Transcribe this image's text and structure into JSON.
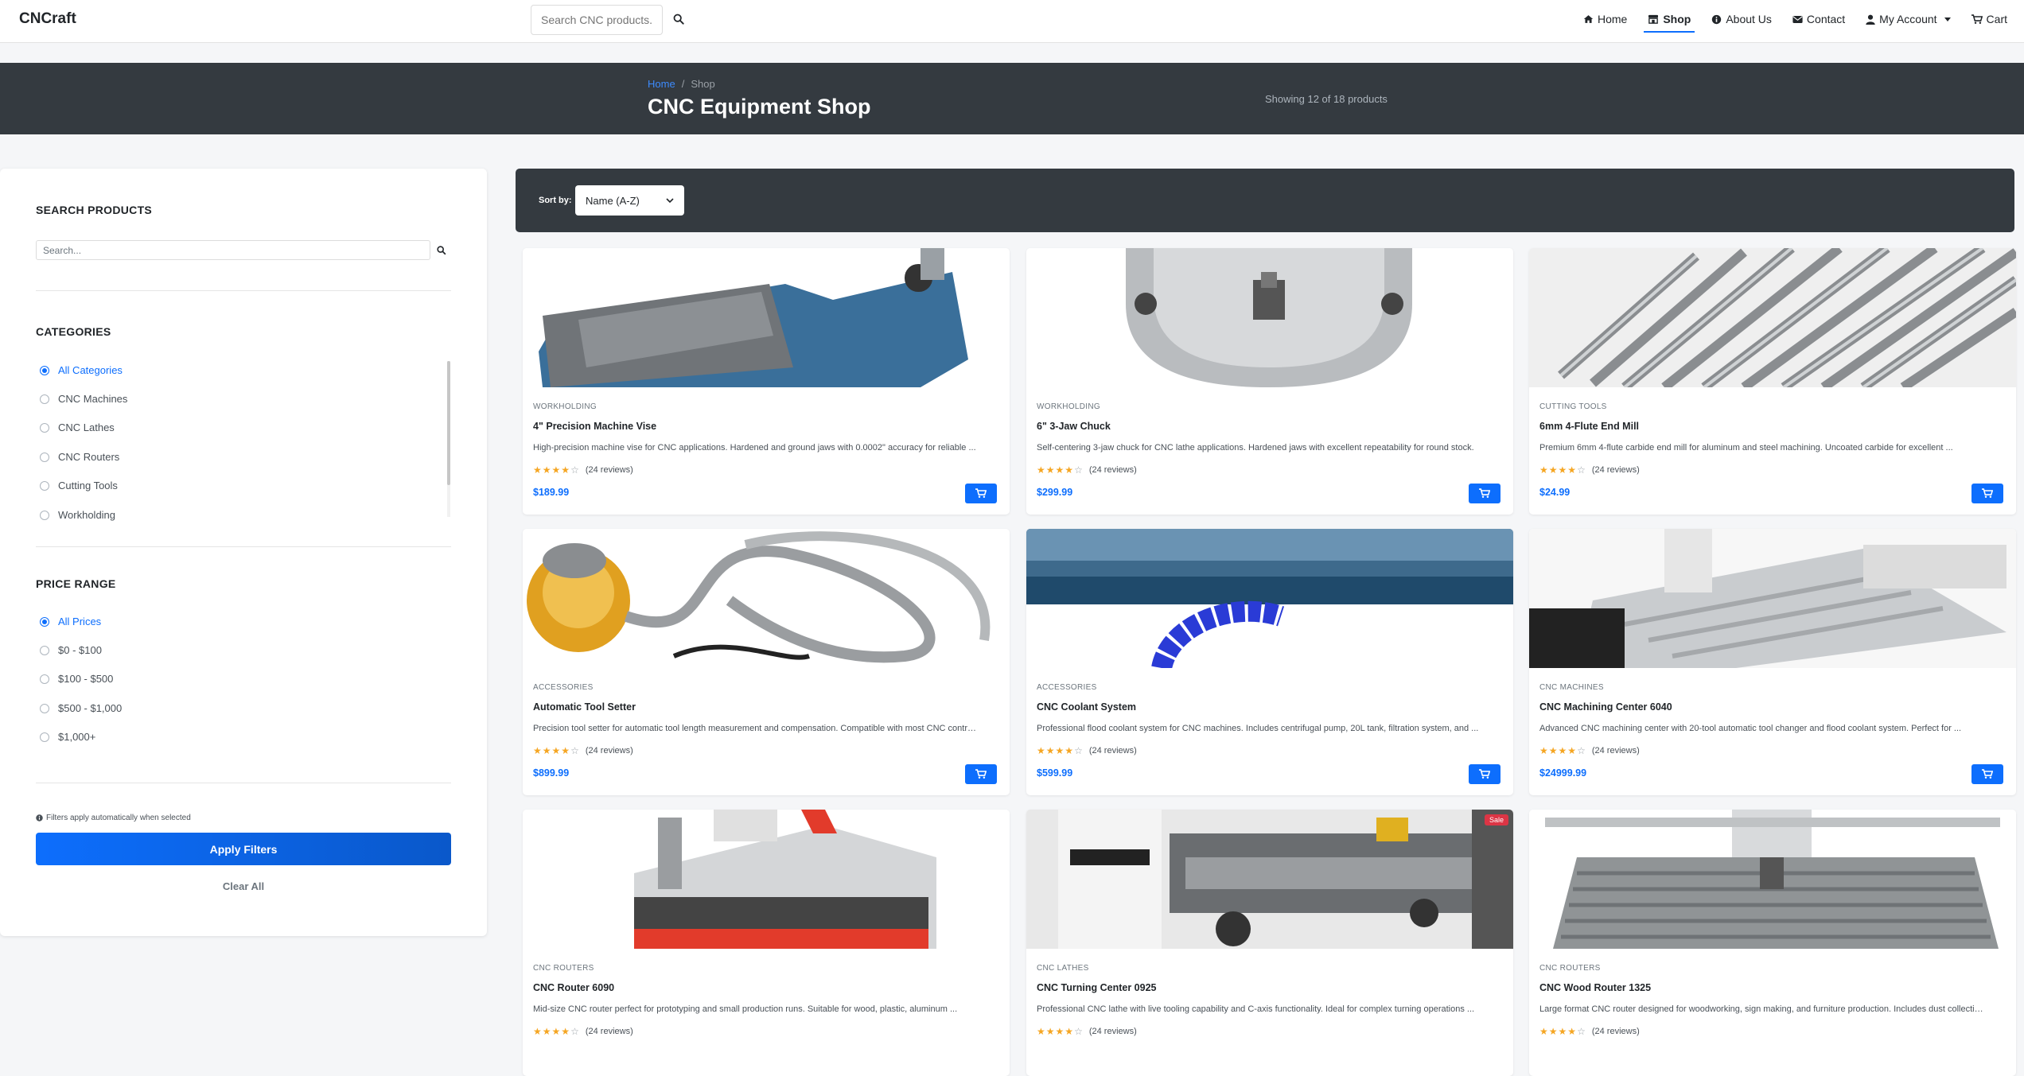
{
  "brand": "CNCraft",
  "nav": {
    "search_placeholder": "Search CNC products...",
    "links": [
      {
        "label": "Home",
        "icon": "home-icon"
      },
      {
        "label": "Shop",
        "icon": "store-icon",
        "active": true
      },
      {
        "label": "About Us",
        "icon": "info-icon"
      },
      {
        "label": "Contact",
        "icon": "envelope-icon"
      },
      {
        "label": "My Account",
        "icon": "user-icon",
        "dropdown": true
      },
      {
        "label": "Cart",
        "icon": "cart-icon"
      }
    ]
  },
  "hero": {
    "breadcrumb": [
      "Home",
      "Shop"
    ],
    "title": "CNC Equipment Shop",
    "count_text": "Showing 12 of 18 products"
  },
  "sidebar": {
    "search_heading": "SEARCH PRODUCTS",
    "search_placeholder": "Search...",
    "categories_heading": "CATEGORIES",
    "categories": [
      "All Categories",
      "CNC Machines",
      "CNC Lathes",
      "CNC Routers",
      "Cutting Tools",
      "Workholding"
    ],
    "selected_category": "All Categories",
    "price_heading": "PRICE RANGE",
    "prices": [
      "All Prices",
      "$0 - $100",
      "$100 - $500",
      "$500 - $1,000",
      "$1,000+"
    ],
    "selected_price": "All Prices",
    "hint": "Filters apply automatically when selected",
    "apply_label": "Apply Filters",
    "clear_label": "Clear All"
  },
  "sort": {
    "label": "Sort by:",
    "value": "Name (A-Z)"
  },
  "colors": {
    "primary": "#0d6efd",
    "dark_band": "#343a40",
    "star": "#f5a623",
    "sale": "#dc3545"
  },
  "products": [
    {
      "category": "WORKHOLDING",
      "name": "4\" Precision Machine Vise",
      "desc": "High-precision machine vise for CNC applications. Hardened and ground jaws with 0.0002\" accuracy for reliable ...",
      "rating": 4,
      "reviews": "(24 reviews)",
      "price": "$189.99",
      "image": "vise"
    },
    {
      "category": "WORKHOLDING",
      "name": "6\" 3-Jaw Chuck",
      "desc": "Self-centering 3-jaw chuck for CNC lathe applications. Hardened jaws with excellent repeatability for round stock.",
      "rating": 4,
      "reviews": "(24 reviews)",
      "price": "$299.99",
      "image": "chuck"
    },
    {
      "category": "CUTTING TOOLS",
      "name": "6mm 4-Flute End Mill",
      "desc": "Premium 6mm 4-flute carbide end mill for aluminum and steel machining. Uncoated carbide for excellent ...",
      "rating": 4,
      "reviews": "(24 reviews)",
      "price": "$24.99",
      "image": "endmill"
    },
    {
      "category": "ACCESSORIES",
      "name": "Automatic Tool Setter",
      "desc": "Precision tool setter for automatic tool length measurement and compensation. Compatible with most CNC controllers.",
      "rating": 4,
      "reviews": "(24 reviews)",
      "price": "$899.99",
      "image": "setter"
    },
    {
      "category": "ACCESSORIES",
      "name": "CNC Coolant System",
      "desc": "Professional flood coolant system for CNC machines. Includes centrifugal pump, 20L tank, filtration system, and ...",
      "rating": 4,
      "reviews": "(24 reviews)",
      "price": "$599.99",
      "image": "coolant"
    },
    {
      "category": "CNC MACHINES",
      "name": "CNC Machining Center 6040",
      "desc": "Advanced CNC machining center with 20-tool automatic tool changer and flood coolant system. Perfect for ...",
      "rating": 4,
      "reviews": "(24 reviews)",
      "price": "$24999.99",
      "image": "machine"
    },
    {
      "category": "CNC ROUTERS",
      "name": "CNC Router 6090",
      "desc": "Mid-size CNC router perfect for prototyping and small production runs. Suitable for wood, plastic, aluminum ...",
      "rating": 4,
      "reviews": "(24 reviews)",
      "price": "",
      "image": "router"
    },
    {
      "category": "CNC LATHES",
      "name": "CNC Turning Center 0925",
      "desc": "Professional CNC lathe with live tooling capability and C-axis functionality. Ideal for complex turning operations ...",
      "rating": 4,
      "reviews": "(24 reviews)",
      "price": "",
      "image": "lathe",
      "badge": "Sale"
    },
    {
      "category": "CNC ROUTERS",
      "name": "CNC Wood Router 1325",
      "desc": "Large format CNC router designed for woodworking, sign making, and furniture production. Includes dust collection ...",
      "rating": 4,
      "reviews": "(24 reviews)",
      "price": "",
      "image": "woodrouter"
    }
  ]
}
